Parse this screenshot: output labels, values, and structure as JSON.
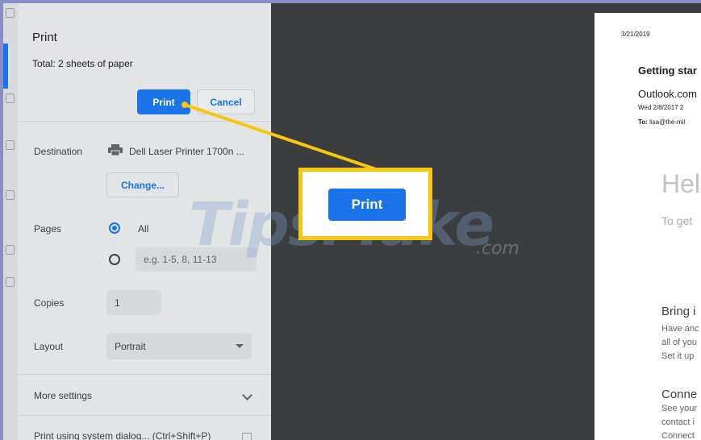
{
  "dialog": {
    "title": "Print",
    "total": "Total: 2 sheets of paper",
    "print_label": "Print",
    "cancel_label": "Cancel",
    "destination_label": "Destination",
    "destination_value": "Dell Laser Printer 1700n ...",
    "change_label": "Change...",
    "pages_label": "Pages",
    "pages_all": "All",
    "pages_custom_placeholder": "e.g. 1-5, 8, 11-13",
    "copies_label": "Copies",
    "copies_value": "1",
    "layout_label": "Layout",
    "layout_value": "Portrait",
    "more_settings": "More settings",
    "system_dialog": "Print using system dialog... (Ctrl+Shift+P)"
  },
  "callout": {
    "print_label": "Print",
    "highlight_color": "#f6c90e",
    "button_color": "#1a73e8"
  },
  "watermark": {
    "text": "TipsMake",
    "suffix": ".com"
  },
  "preview": {
    "date": "3/21/2019",
    "heading": "Getting star",
    "from": "Outlook.com",
    "sent": "Wed 2/8/2017 2",
    "to_label": "To:",
    "to_value": "lisa@the-mil",
    "hello": "Hel",
    "to_get": "To get",
    "bring": "Bring i",
    "line1": "Have anc",
    "line2": "all of you",
    "line3": "Set it up",
    "conn": "Conne",
    "line4": "See your",
    "line5": "contact i",
    "line6": "Connect"
  }
}
